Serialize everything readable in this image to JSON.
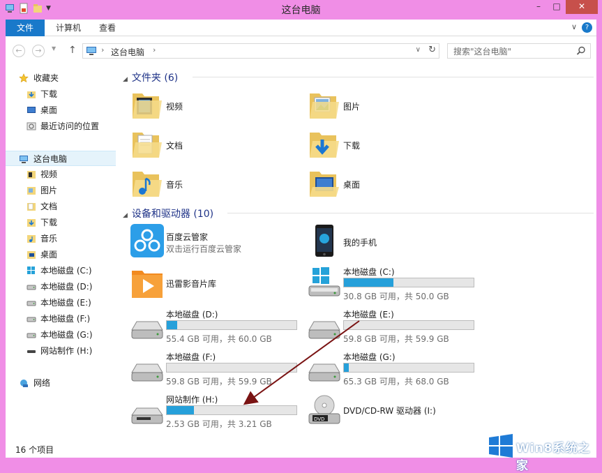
{
  "window": {
    "title": "这台电脑"
  },
  "ribbon": {
    "tabs": [
      "文件",
      "计算机",
      "查看"
    ],
    "help": "?"
  },
  "address": {
    "crumb": "这台电脑"
  },
  "search": {
    "placeholder": "搜索\"这台电脑\""
  },
  "nav": {
    "favorites_label": "收藏夹",
    "favorites": [
      "下载",
      "桌面",
      "最近访问的位置"
    ],
    "thispc_label": "这台电脑",
    "thispc_items": [
      "视频",
      "图片",
      "文档",
      "下载",
      "音乐",
      "桌面",
      "本地磁盘 (C:)",
      "本地磁盘 (D:)",
      "本地磁盘 (E:)",
      "本地磁盘 (F:)",
      "本地磁盘 (G:)",
      "网站制作 (H:)"
    ],
    "network_label": "网络"
  },
  "folders": {
    "header": "文件夹 (6)",
    "items": [
      "视频",
      "图片",
      "文档",
      "下载",
      "音乐",
      "桌面"
    ]
  },
  "devices": {
    "header": "设备和驱动器 (10)",
    "items": [
      {
        "name": "百度云管家",
        "sub": "双击运行百度云管家"
      },
      {
        "name": "我的手机"
      },
      {
        "name": "迅雷影音片库"
      },
      {
        "name": "本地磁盘 (C:)",
        "sub": "30.8 GB 可用，共 50.0 GB",
        "used_fraction": 0.38
      },
      {
        "name": "本地磁盘 (D:)",
        "sub": "55.4 GB 可用，共 60.0 GB",
        "used_fraction": 0.08
      },
      {
        "name": "本地磁盘 (E:)",
        "sub": "59.8 GB 可用，共 59.9 GB",
        "used_fraction": 0.0
      },
      {
        "name": "本地磁盘 (F:)",
        "sub": "59.8 GB 可用，共 59.9 GB",
        "used_fraction": 0.0
      },
      {
        "name": "本地磁盘 (G:)",
        "sub": "65.3 GB 可用，共 68.0 GB",
        "used_fraction": 0.04
      },
      {
        "name": "网站制作 (H:)",
        "sub": "2.53 GB 可用，共 3.21 GB",
        "used_fraction": 0.21
      },
      {
        "name": "DVD/CD-RW 驱动器 (I:)"
      }
    ]
  },
  "status": {
    "count": "16 个项目"
  },
  "watermark": {
    "text": "Win8系统之家"
  },
  "colors": {
    "titlebar": "#f08ee6",
    "accent": "#1979ca",
    "bar_fill": "#26a0da",
    "arrow": "#7a1313"
  }
}
